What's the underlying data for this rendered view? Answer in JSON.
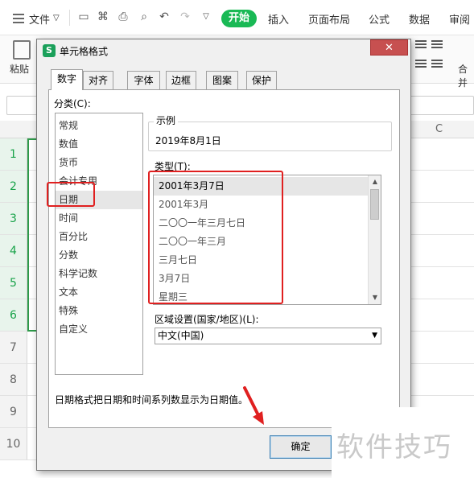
{
  "app": {
    "menu": {
      "file_label": "文件",
      "start_label": "开始",
      "tabs": [
        "插入",
        "页面布局",
        "公式",
        "数据",
        "审阅"
      ]
    },
    "toolbar": {
      "paste_label": "粘贴",
      "merge_label": "合并"
    },
    "sheet": {
      "column_c": "C",
      "rows": [
        "1",
        "2",
        "3",
        "4",
        "5",
        "6",
        "7",
        "8",
        "9",
        "10"
      ]
    }
  },
  "dialog": {
    "title": "单元格格式",
    "app_icon_letter": "S",
    "close_symbol": "✕",
    "tabs": [
      "数字",
      "对齐",
      "字体",
      "边框",
      "图案",
      "保护"
    ],
    "active_tab": "数字",
    "category_label": "分类(C):",
    "categories": [
      "常规",
      "数值",
      "货币",
      "会计专用",
      "日期",
      "时间",
      "百分比",
      "分数",
      "科学记数",
      "文本",
      "特殊",
      "自定义"
    ],
    "selected_category": "日期",
    "sample_label": "示例",
    "sample_value": "2019年8月1日",
    "type_label": "类型(T):",
    "types": [
      "2001年3月7日",
      "2001年3月",
      "二〇〇一年三月七日",
      "二〇〇一年三月",
      "三月七日",
      "3月7日",
      "星期三"
    ],
    "selected_type": "2001年3月7日",
    "region_label": "区域设置(国家/地区)(L):",
    "region_value": "中文(中国)",
    "description": "日期格式把日期和时间系列数显示为日期值。",
    "ok_label": "确定"
  },
  "annotations": {
    "highlight_color": "#e02020"
  },
  "watermark": "软件技巧"
}
